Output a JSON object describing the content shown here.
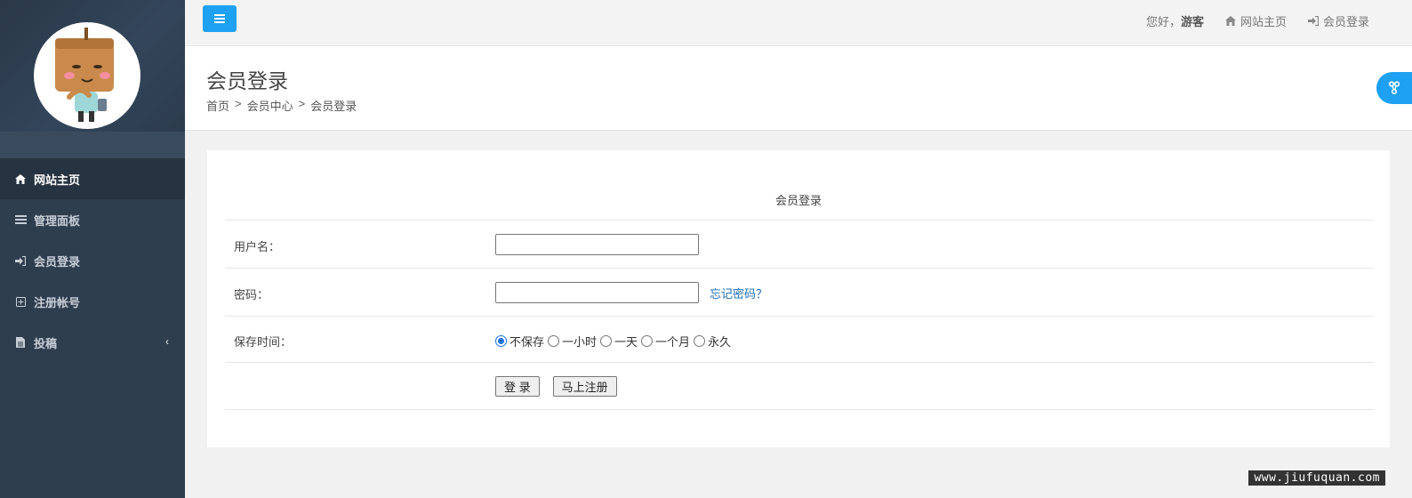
{
  "sidebar": {
    "items": [
      {
        "label": "网站主页",
        "icon": "home-icon"
      },
      {
        "label": "管理面板",
        "icon": "list-icon"
      },
      {
        "label": "会员登录",
        "icon": "sign-in-icon"
      },
      {
        "label": "注册帐号",
        "icon": "plus-square-icon"
      },
      {
        "label": "投稿",
        "icon": "file-icon"
      }
    ],
    "active_index": 0
  },
  "topbar": {
    "greeting": "您好，",
    "username": "游客",
    "home_link": "网站主页",
    "login_link": "会员登录"
  },
  "header": {
    "title": "会员登录",
    "breadcrumb": [
      "首页",
      "会员中心",
      "会员登录"
    ],
    "separator": ">"
  },
  "form": {
    "title": "会员登录",
    "username_label": "用户名：",
    "username_value": "",
    "password_label": "密码：",
    "password_value": "",
    "forgot_link": "忘记密码？",
    "save_label": "保存时间：",
    "save_options": [
      "不保存",
      "一小时",
      "一天",
      "一个月",
      "永久"
    ],
    "save_selected": "不保存",
    "login_button": "登 录",
    "register_button": "马上注册"
  },
  "watermark": "www.jiufuquan.com",
  "colors": {
    "sidebar_bg": "#2f3e4f",
    "accent": "#1ea1f2",
    "link": "#1f6fb2"
  }
}
